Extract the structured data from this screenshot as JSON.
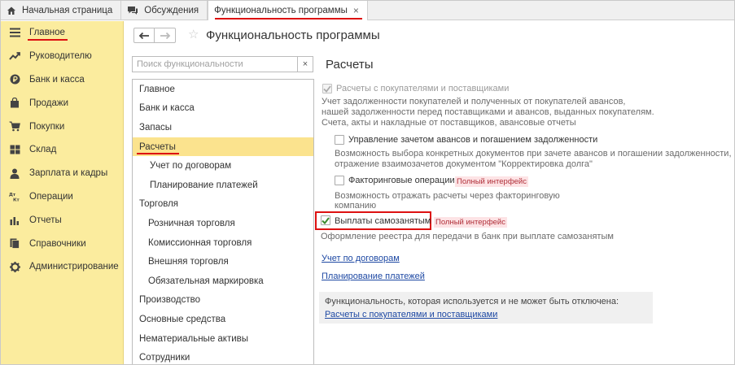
{
  "tabs": [
    {
      "label": "Начальная страница",
      "icon": "home-icon"
    },
    {
      "label": "Обсуждения",
      "icon": "chat-icon"
    },
    {
      "label": "Функциональность программы",
      "icon": "",
      "active": true,
      "close": "×"
    }
  ],
  "sidebar": {
    "items": [
      {
        "label": "Главное",
        "icon": "menu-icon",
        "active": true
      },
      {
        "label": "Руководителю",
        "icon": "trend-icon"
      },
      {
        "label": "Банк и касса",
        "icon": "ruble-icon"
      },
      {
        "label": "Продажи",
        "icon": "bag-icon"
      },
      {
        "label": "Покупки",
        "icon": "cart-icon"
      },
      {
        "label": "Склад",
        "icon": "warehouse-icon"
      },
      {
        "label": "Зарплата и кадры",
        "icon": "person-icon"
      },
      {
        "label": "Операции",
        "icon": "dt-kt-icon"
      },
      {
        "label": "Отчеты",
        "icon": "bar-chart-icon"
      },
      {
        "label": "Справочники",
        "icon": "books-icon"
      },
      {
        "label": "Администрирование",
        "icon": "gear-icon"
      }
    ]
  },
  "header": {
    "title": "Функциональность программы",
    "back": "🡐",
    "forward": "🡒",
    "star": "☆"
  },
  "search": {
    "placeholder": "Поиск функциональности",
    "clear": "×"
  },
  "tree": {
    "items": [
      {
        "label": "Главное",
        "level": 0
      },
      {
        "label": "Банк и касса",
        "level": 0
      },
      {
        "label": "Запасы",
        "level": 0
      },
      {
        "label": "Расчеты",
        "level": 0,
        "selected": true
      },
      {
        "label": "Учет по договорам",
        "level": 1
      },
      {
        "label": "Планирование платежей",
        "level": 1
      },
      {
        "label": "Торговля",
        "level": 0
      },
      {
        "label": "Розничная торговля",
        "level": 1
      },
      {
        "label": "Комиссионная торговля",
        "level": 1
      },
      {
        "label": "Внешняя торговля",
        "level": 1
      },
      {
        "label": "Обязательная маркировка",
        "level": 1
      },
      {
        "label": "Производство",
        "level": 0
      },
      {
        "label": "Основные средства",
        "level": 0
      },
      {
        "label": "Нематериальные активы",
        "level": 0
      },
      {
        "label": "Сотрудники",
        "level": 0
      }
    ]
  },
  "section": {
    "title": "Расчеты",
    "options": {
      "customers": {
        "label": "Расчеты с покупателями и поставщиками",
        "checked": true,
        "disabled": true,
        "desc1": "Учет задолженности покупателей и полученных от покупателей авансов,",
        "desc2": "нашей задолженности перед поставщиками и авансов, выданных покупателям.",
        "desc3": "Счета, акты и накладные от поставщиков, авансовые отчеты"
      },
      "advances": {
        "label": "Управление зачетом авансов и погашением задолженности",
        "checked": false,
        "desc1": "Возможность выбора конкретных документов при зачете авансов и погашении задолженности,",
        "desc2": "отражение взаимозачетов документом \"Корректировка долга\""
      },
      "factoring": {
        "label": "Факторинговые операции",
        "checked": false,
        "badge": "Полный интерфейс",
        "desc1": "Возможность отражать расчеты через факторинговую",
        "desc2": "компанию"
      },
      "selfemployed": {
        "label": "Выплаты самозанятым",
        "checked": true,
        "badge": "Полный интерфейс",
        "desc1": "Оформление реестра для передачи в банк при выплате самозанятым"
      }
    },
    "links": {
      "contracts": "Учет по договорам",
      "planning": "Планирование платежей"
    },
    "info": {
      "text": "Функциональность, которая используется и не может быть отключена:",
      "link": "Расчеты с покупателями и поставщиками"
    }
  },
  "colors": {
    "sidebar_bg": "#fbec9e",
    "selected_bg": "#fbe38e",
    "accent_red": "#dd1111",
    "link": "#1d48a3",
    "checkmark": "#3a8a2e"
  }
}
